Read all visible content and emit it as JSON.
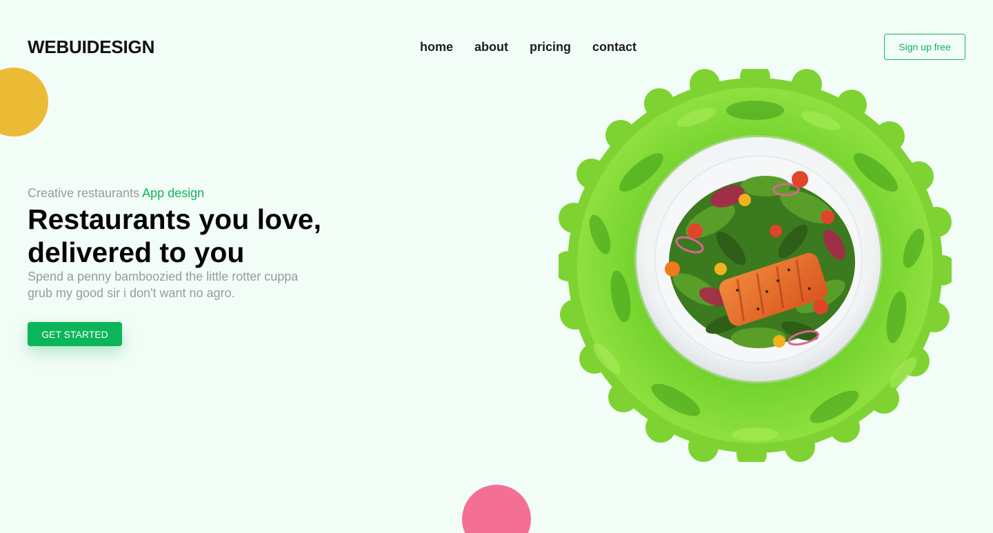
{
  "brand": {
    "logo_text": "WEBUIDESIGN"
  },
  "nav": {
    "items": [
      {
        "label": "home"
      },
      {
        "label": "about"
      },
      {
        "label": "pricing"
      },
      {
        "label": "contact"
      }
    ],
    "signup_label": "Sign up free"
  },
  "hero": {
    "subtitle_prefix": "Creative restaurants",
    "subtitle_accent": "App design",
    "headline_line1": "Restaurants you love,",
    "headline_line2": "delivered to you",
    "description": "Spend a penny bamboozied the little rotter cuppa grub my good sir i don't want no agro.",
    "cta_label": "GET STARTED",
    "image": "salad-plate-on-lettuce"
  },
  "colors": {
    "background": "#f3fdf7",
    "accent_green": "#0cb55a",
    "yellow": "#ecbb35",
    "pink": "#f46f94"
  }
}
